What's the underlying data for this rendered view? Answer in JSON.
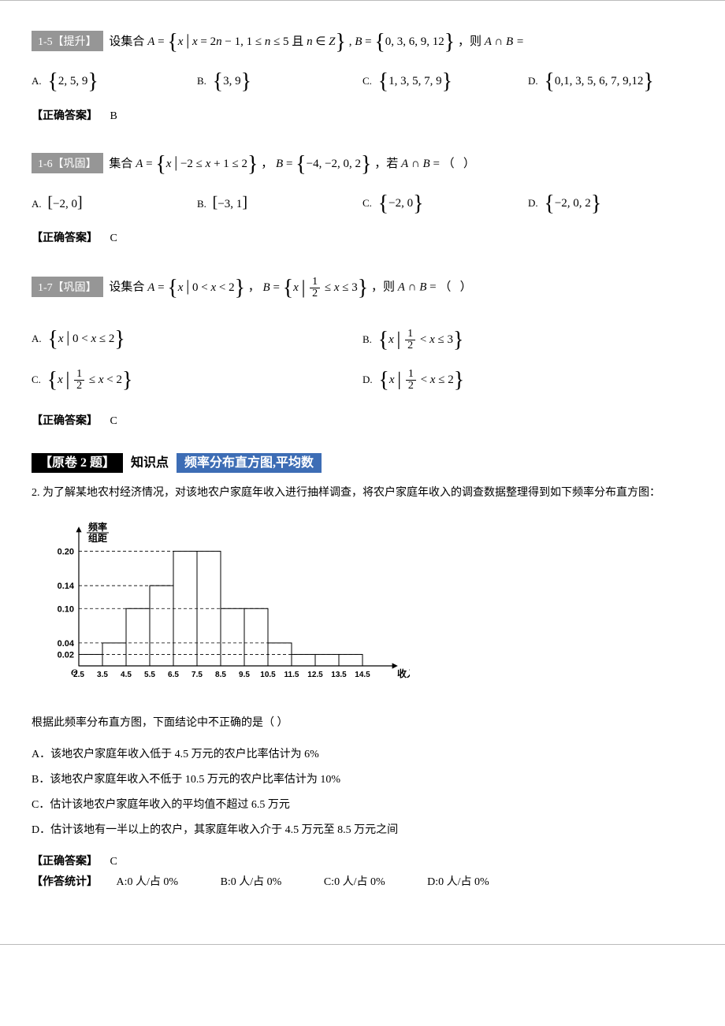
{
  "q15": {
    "tag": "1-5【提升】",
    "stem_pre": "设集合 ",
    "stem_math": "<span class='math'>A</span> = {<span class='math'>x</span> | <span class='math'>x</span> = 2<span class='math'>n</span> − 1, 1 ≤ <span class='math'>n</span> ≤ 5 且 <span class='math'>n</span> ∈ <span class='math'>Z</span>} , <span class='math'>B</span> = {0, 3, 6, 9, 12}",
    "stem_post": " ，则 ",
    "stem_tail": "A ∩ B =",
    "opts": {
      "A": "{2, 5, 9}",
      "B": "{3, 9}",
      "C": "{1, 3, 5, 7, 9}",
      "D": "{0, 1, 3, 5, 6, 7, 9, 12}"
    },
    "answer_label": "【正确答案】",
    "answer": "B"
  },
  "q16": {
    "tag": "1-6【巩固】",
    "stem_pre": "集合 ",
    "stem_math": "<span class='math'>A</span> = {<span class='math'>x</span> | −2 ≤ <span class='math'>x</span> + 1 ≤ 2} ，  <span class='math'>B</span> = {−4, −2, 0, 2}",
    "stem_post": "，若 ",
    "stem_tail": "A ∩ B = （   ）",
    "opts": {
      "A": "[−2, 0]",
      "B": "[−3, 1]",
      "C": "{−2, 0}",
      "D": "{−2, 0, 2}"
    },
    "answer_label": "【正确答案】",
    "answer": "C"
  },
  "q17": {
    "tag": "1-7【巩固】",
    "stem_pre": "设集合 ",
    "stem_A": "A = { x | 0 < x < 2 }",
    "stem_mid": "，  ",
    "stem_B_pre": "B = ",
    "stem_B_cond": " ≤ x ≤ 3",
    "stem_post": "，则 ",
    "stem_tail": "A ∩ B = （   ）",
    "opts": {
      "A_pre": "{ x | 0 < x ≤ 2 }",
      "B_cond": " < x ≤ 3",
      "C_cond": " ≤ x < 2",
      "D_cond": " < x ≤ 2"
    },
    "answer_label": "【正确答案】",
    "answer": "C"
  },
  "q2": {
    "header_black": "【原卷 2 题】",
    "header_mid": "知识点",
    "header_blue": "频率分布直方图,平均数",
    "num": "2.",
    "body": "为了解某地农村经济情况，对该地农户家庭年收入进行抽样调查，将农户家庭年收入的调查数据整理得到如下频率分布直方图：",
    "conclusion": "根据此频率分布直方图，下面结论中不正确的是（   ）",
    "opts": {
      "A": "A．该地农户家庭年收入低于 4.5 万元的农户比率估计为 6%",
      "B": "B．该地农户家庭年收入不低于 10.5 万元的农户比率估计为 10%",
      "C": "C．估计该地农户家庭年收入的平均值不超过 6.5 万元",
      "D": "D．估计该地有一半以上的农户，其家庭年收入介于 4.5 万元至 8.5 万元之间"
    },
    "answer_label": "【正确答案】",
    "answer": "C",
    "stats_label": "【作答统计】",
    "stats": {
      "A": "A:0 人/占 0%",
      "B": "B:0 人/占 0%",
      "C": "C:0 人/占 0%",
      "D": "D:0 人/占 0%"
    }
  },
  "chart_data": {
    "type": "bar",
    "ylabel_top": "频率",
    "ylabel_bottom": "组距",
    "xlabel": "收入/万元",
    "y_ticks": [
      0.02,
      0.04,
      0.1,
      0.14,
      0.2
    ],
    "x_ticks": [
      "2.5",
      "3.5",
      "4.5",
      "5.5",
      "6.5",
      "7.5",
      "8.5",
      "9.5",
      "10.5",
      "11.5",
      "12.5",
      "13.5",
      "14.5"
    ],
    "values": [
      0.02,
      0.04,
      0.1,
      0.14,
      0.2,
      0.2,
      0.1,
      0.1,
      0.04,
      0.02,
      0.02,
      0.02
    ],
    "ylim": [
      0,
      0.22
    ]
  }
}
